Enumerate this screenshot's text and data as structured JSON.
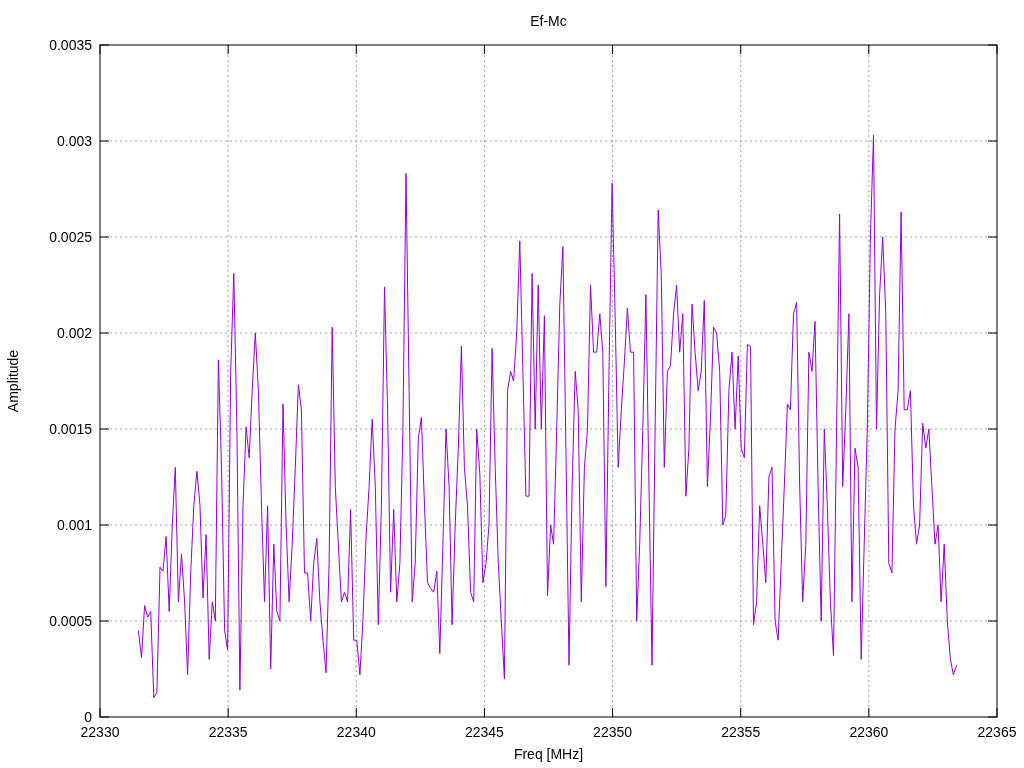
{
  "chart_data": {
    "type": "line",
    "title": "Ef-Mc",
    "xlabel": "Freq [MHz]",
    "ylabel": "Amplitude",
    "xlim": [
      22330,
      22365
    ],
    "ylim": [
      0,
      0.0035
    ],
    "grid": true,
    "xticks": [
      22330,
      22335,
      22340,
      22345,
      22350,
      22355,
      22360,
      22365
    ],
    "yticks": [
      0,
      0.0005,
      0.001,
      0.0015,
      0.002,
      0.0025,
      0.003,
      0.0035
    ],
    "x": [
      22331.5,
      22331.62,
      22331.74,
      22331.86,
      22331.98,
      22332.1,
      22332.22,
      22332.34,
      22332.46,
      22332.58,
      22332.7,
      22332.82,
      22332.94,
      22333.06,
      22333.18,
      22333.3,
      22333.42,
      22333.54,
      22333.66,
      22333.78,
      22333.9,
      22334.02,
      22334.14,
      22334.26,
      22334.38,
      22334.5,
      22334.62,
      22334.74,
      22334.86,
      22334.98,
      22335.1,
      22335.22,
      22335.34,
      22335.46,
      22335.58,
      22335.7,
      22335.82,
      22335.94,
      22336.06,
      22336.18,
      22336.3,
      22336.42,
      22336.54,
      22336.66,
      22336.78,
      22336.9,
      22337.02,
      22337.14,
      22337.26,
      22337.38,
      22337.5,
      22337.62,
      22337.74,
      22337.86,
      22337.98,
      22338.1,
      22338.22,
      22338.34,
      22338.46,
      22338.58,
      22338.7,
      22338.82,
      22338.94,
      22339.06,
      22339.18,
      22339.3,
      22339.42,
      22339.54,
      22339.66,
      22339.78,
      22339.9,
      22340.02,
      22340.14,
      22340.26,
      22340.38,
      22340.5,
      22340.62,
      22340.74,
      22340.86,
      22340.98,
      22341.1,
      22341.22,
      22341.34,
      22341.46,
      22341.58,
      22341.7,
      22341.82,
      22341.94,
      22342.06,
      22342.18,
      22342.3,
      22342.42,
      22342.54,
      22342.66,
      22342.78,
      22342.9,
      22343.02,
      22343.14,
      22343.26,
      22343.38,
      22343.5,
      22343.62,
      22343.74,
      22343.86,
      22343.98,
      22344.1,
      22344.22,
      22344.34,
      22344.46,
      22344.58,
      22344.7,
      22344.82,
      22344.94,
      22345.06,
      22345.18,
      22345.3,
      22345.42,
      22345.54,
      22345.66,
      22345.78,
      22345.9,
      22346.02,
      22346.14,
      22346.26,
      22346.38,
      22346.5,
      22346.62,
      22346.74,
      22346.86,
      22346.98,
      22347.1,
      22347.22,
      22347.34,
      22347.46,
      22347.58,
      22347.7,
      22347.82,
      22347.94,
      22348.06,
      22348.18,
      22348.3,
      22348.42,
      22348.54,
      22348.66,
      22348.78,
      22348.9,
      22349.02,
      22349.14,
      22349.26,
      22349.38,
      22349.5,
      22349.62,
      22349.74,
      22349.86,
      22349.98,
      22350.1,
      22350.22,
      22350.34,
      22350.46,
      22350.58,
      22350.7,
      22350.82,
      22350.94,
      22351.06,
      22351.18,
      22351.3,
      22351.42,
      22351.54,
      22351.66,
      22351.78,
      22351.9,
      22352.02,
      22352.14,
      22352.26,
      22352.38,
      22352.5,
      22352.62,
      22352.74,
      22352.86,
      22352.98,
      22353.1,
      22353.22,
      22353.34,
      22353.46,
      22353.58,
      22353.7,
      22353.82,
      22353.94,
      22354.06,
      22354.18,
      22354.3,
      22354.42,
      22354.54,
      22354.66,
      22354.78,
      22354.9,
      22355.02,
      22355.14,
      22355.26,
      22355.38,
      22355.5,
      22355.62,
      22355.74,
      22355.86,
      22355.98,
      22356.1,
      22356.22,
      22356.34,
      22356.46,
      22356.58,
      22356.7,
      22356.82,
      22356.94,
      22357.06,
      22357.18,
      22357.3,
      22357.42,
      22357.54,
      22357.66,
      22357.78,
      22357.9,
      22358.02,
      22358.14,
      22358.26,
      22358.38,
      22358.5,
      22358.62,
      22358.74,
      22358.86,
      22358.98,
      22359.1,
      22359.22,
      22359.34,
      22359.46,
      22359.58,
      22359.7,
      22359.82,
      22359.94,
      22360.06,
      22360.18,
      22360.3,
      22360.42,
      22360.54,
      22360.66,
      22360.78,
      22360.9,
      22361.02,
      22361.14,
      22361.26,
      22361.38,
      22361.5,
      22361.62,
      22361.74,
      22361.86,
      22361.98,
      22362.1,
      22362.22,
      22362.34,
      22362.46,
      22362.58,
      22362.7,
      22362.82,
      22362.94,
      22363.06,
      22363.18,
      22363.3,
      22363.42
    ],
    "series": [
      {
        "color": "#9400d3",
        "values": [
          0.00045,
          0.00031,
          0.00058,
          0.00052,
          0.00055,
          0.0001,
          0.00013,
          0.00078,
          0.00076,
          0.00094,
          0.00055,
          0.001,
          0.0013,
          0.0006,
          0.00085,
          0.0006,
          0.00022,
          0.00075,
          0.0011,
          0.00128,
          0.0011,
          0.00062,
          0.00095,
          0.0003,
          0.0006,
          0.0005,
          0.00186,
          0.0013,
          0.00045,
          0.00035,
          0.0018,
          0.00231,
          0.0015,
          0.00014,
          0.0011,
          0.00151,
          0.00135,
          0.0017,
          0.002,
          0.0017,
          0.0011,
          0.0006,
          0.0011,
          0.00025,
          0.0009,
          0.00055,
          0.0005,
          0.00163,
          0.001,
          0.0006,
          0.0009,
          0.0013,
          0.00173,
          0.0016,
          0.00075,
          0.00075,
          0.0005,
          0.0008,
          0.00093,
          0.0006,
          0.0004,
          0.00023,
          0.0008,
          0.00203,
          0.0012,
          0.0009,
          0.0006,
          0.00065,
          0.0006,
          0.00108,
          0.0004,
          0.0004,
          0.00022,
          0.0005,
          0.00093,
          0.0012,
          0.00155,
          0.0012,
          0.00048,
          0.0011,
          0.00224,
          0.0016,
          0.00065,
          0.00108,
          0.0006,
          0.0008,
          0.0015,
          0.00283,
          0.0017,
          0.0006,
          0.0008,
          0.00145,
          0.00156,
          0.0011,
          0.0007,
          0.00067,
          0.00065,
          0.00076,
          0.00033,
          0.0009,
          0.0015,
          0.0012,
          0.00048,
          0.001,
          0.0014,
          0.00193,
          0.0013,
          0.0011,
          0.00065,
          0.0006,
          0.0015,
          0.00127,
          0.0007,
          0.0008,
          0.001,
          0.00192,
          0.0013,
          0.0008,
          0.0005,
          0.0002,
          0.0017,
          0.0018,
          0.00175,
          0.002,
          0.00248,
          0.0018,
          0.00115,
          0.00115,
          0.00231,
          0.0015,
          0.00225,
          0.0015,
          0.00209,
          0.00063,
          0.001,
          0.0009,
          0.0015,
          0.00215,
          0.00245,
          0.0014,
          0.00027,
          0.0012,
          0.0018,
          0.0016,
          0.0006,
          0.0013,
          0.0015,
          0.00225,
          0.0019,
          0.0019,
          0.0021,
          0.0019,
          0.00068,
          0.0018,
          0.00278,
          0.0021,
          0.0013,
          0.0016,
          0.00185,
          0.00213,
          0.0019,
          0.0019,
          0.0005,
          0.0009,
          0.0015,
          0.0022,
          0.0012,
          0.00027,
          0.0015,
          0.00264,
          0.0023,
          0.0013,
          0.0018,
          0.00183,
          0.0021,
          0.00225,
          0.0019,
          0.0021,
          0.00115,
          0.0014,
          0.00215,
          0.0019,
          0.0017,
          0.0018,
          0.00217,
          0.0012,
          0.00156,
          0.00203,
          0.002,
          0.0018,
          0.001,
          0.00105,
          0.0017,
          0.0019,
          0.0015,
          0.00188,
          0.0014,
          0.00135,
          0.00194,
          0.00193,
          0.00048,
          0.0006,
          0.0011,
          0.0009,
          0.0007,
          0.00125,
          0.0013,
          0.0005,
          0.0004,
          0.0008,
          0.0012,
          0.00163,
          0.0016,
          0.0021,
          0.00216,
          0.0012,
          0.0006,
          0.0009,
          0.0019,
          0.0018,
          0.00206,
          0.0012,
          0.0005,
          0.0015,
          0.0011,
          0.0006,
          0.00032,
          0.0015,
          0.00262,
          0.0012,
          0.0016,
          0.0021,
          0.0006,
          0.0014,
          0.0013,
          0.0003,
          0.0009,
          0.0015,
          0.0025,
          0.00303,
          0.0015,
          0.0022,
          0.0025,
          0.0021,
          0.0008,
          0.00075,
          0.0015,
          0.0017,
          0.00263,
          0.0016,
          0.0016,
          0.0017,
          0.0011,
          0.0009,
          0.001,
          0.00153,
          0.0014,
          0.0015,
          0.0012,
          0.0009,
          0.001,
          0.0006,
          0.0009,
          0.0005,
          0.0003,
          0.00022,
          0.00027
        ]
      }
    ]
  }
}
